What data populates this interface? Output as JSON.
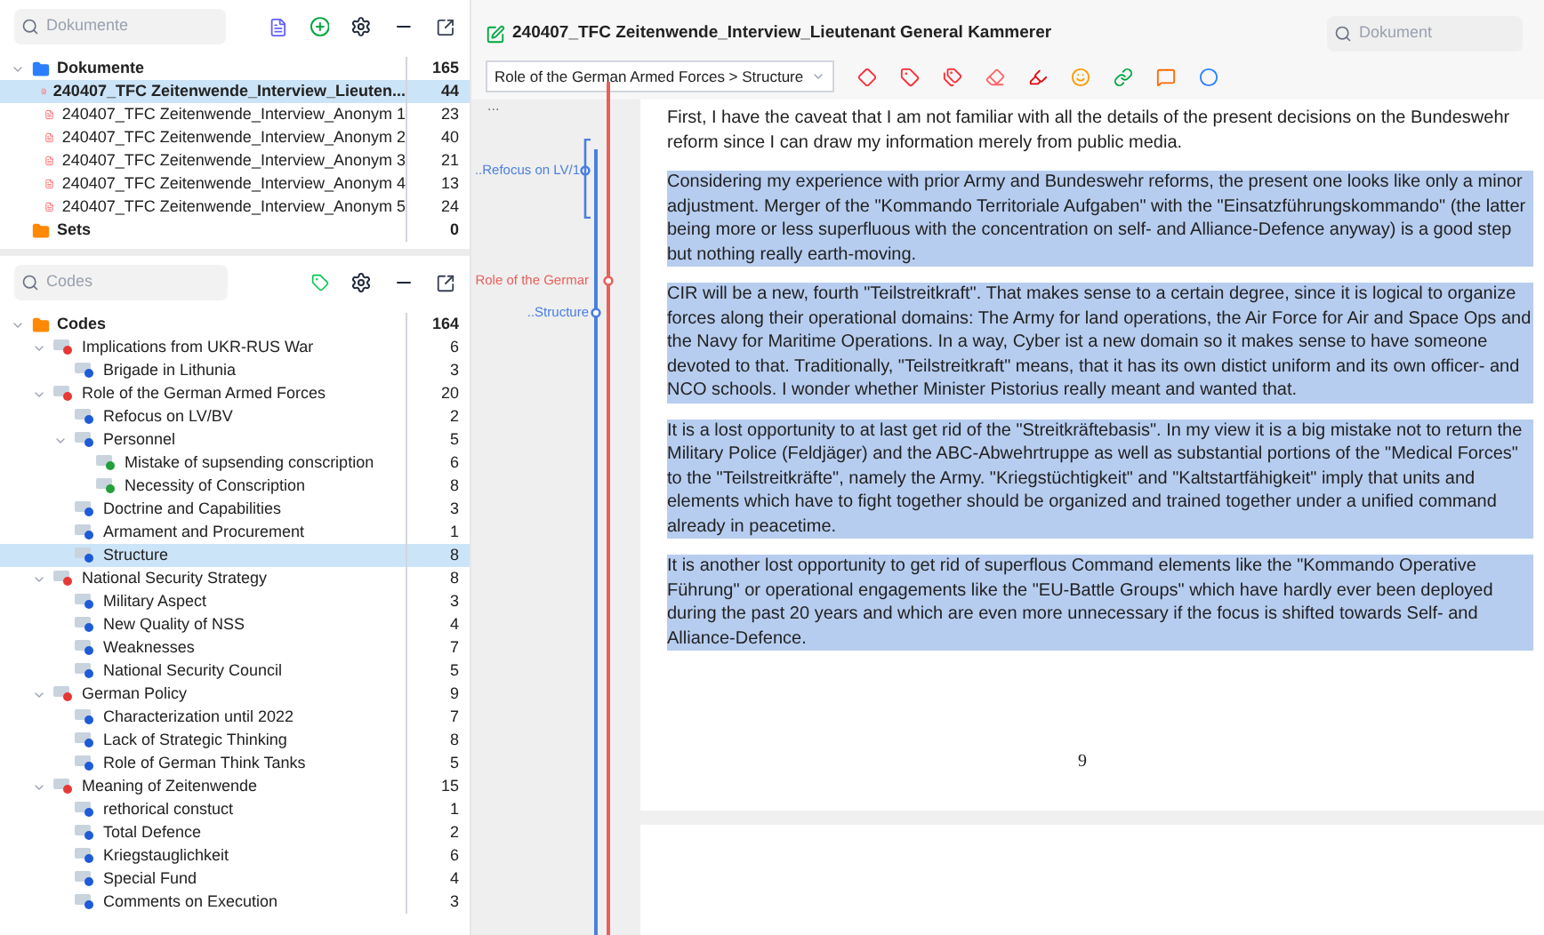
{
  "documents_panel": {
    "search": {
      "placeholder": "Dokumente"
    },
    "root": {
      "label": "Dokumente",
      "count": "165",
      "expanded": true
    },
    "documents": [
      {
        "label": "240407_TFC Zeitenwende_Interview_Lieuten...",
        "count": "44",
        "selected": true
      },
      {
        "label": "240407_TFC Zeitenwende_Interview_Anonym 1",
        "count": "23",
        "selected": false
      },
      {
        "label": "240407_TFC Zeitenwende_Interview_Anonym 2",
        "count": "40",
        "selected": false
      },
      {
        "label": "240407_TFC Zeitenwende_Interview_Anonym 3",
        "count": "21",
        "selected": false
      },
      {
        "label": "240407_TFC Zeitenwende_Interview_Anonym 4",
        "count": "13",
        "selected": false
      },
      {
        "label": "240407_TFC Zeitenwende_Interview_Anonym 5",
        "count": "24",
        "selected": false
      }
    ],
    "sets": {
      "label": "Sets",
      "count": "0"
    }
  },
  "codes_panel": {
    "search": {
      "placeholder": "Codes"
    },
    "root": {
      "label": "Codes",
      "count": "164",
      "expanded": true
    },
    "codes": [
      {
        "label": "Implications from UKR-RUS War",
        "count": "6",
        "color": "#e53935",
        "selected": false,
        "expanded": true,
        "children": [
          {
            "label": "Brigade in Lithunia",
            "count": "3",
            "color": "#1e5bd8",
            "selected": false
          }
        ]
      },
      {
        "label": "Role of the German Armed Forces",
        "count": "20",
        "color": "#e53935",
        "selected": false,
        "expanded": true,
        "children": [
          {
            "label": "Refocus on LV/BV",
            "count": "2",
            "color": "#1e5bd8",
            "selected": false
          },
          {
            "label": "Personnel",
            "count": "5",
            "color": "#1e5bd8",
            "selected": false,
            "expanded": true,
            "children": [
              {
                "label": "Mistake of supsending conscription",
                "count": "6",
                "color": "#22a03a",
                "selected": false
              },
              {
                "label": "Necessity of Conscription",
                "count": "8",
                "color": "#22a03a",
                "selected": false
              }
            ]
          },
          {
            "label": "Doctrine and Capabilities",
            "count": "3",
            "color": "#1e5bd8",
            "selected": false
          },
          {
            "label": "Armament and Procurement",
            "count": "1",
            "color": "#1e5bd8",
            "selected": false
          },
          {
            "label": "Structure",
            "count": "8",
            "color": "#1e5bd8",
            "selected": true
          }
        ]
      },
      {
        "label": "National Security Strategy",
        "count": "8",
        "color": "#e53935",
        "selected": false,
        "expanded": true,
        "children": [
          {
            "label": "Military Aspect",
            "count": "3",
            "color": "#1e5bd8",
            "selected": false
          },
          {
            "label": "New Quality of NSS",
            "count": "4",
            "color": "#1e5bd8",
            "selected": false
          },
          {
            "label": "Weaknesses",
            "count": "7",
            "color": "#1e5bd8",
            "selected": false
          },
          {
            "label": "National Security Council",
            "count": "5",
            "color": "#1e5bd8",
            "selected": false
          }
        ]
      },
      {
        "label": "German Policy",
        "count": "9",
        "color": "#e53935",
        "selected": false,
        "expanded": true,
        "children": [
          {
            "label": "Characterization until 2022",
            "count": "7",
            "color": "#1e5bd8",
            "selected": false
          },
          {
            "label": "Lack of Strategic Thinking",
            "count": "8",
            "color": "#1e5bd8",
            "selected": false
          },
          {
            "label": "Role of German Think Tanks",
            "count": "5",
            "color": "#1e5bd8",
            "selected": false
          }
        ]
      },
      {
        "label": "Meaning of Zeitenwende",
        "count": "15",
        "color": "#e53935",
        "selected": false,
        "expanded": true,
        "children": [
          {
            "label": "rethorical constuct",
            "count": "1",
            "color": "#1e5bd8",
            "selected": false
          },
          {
            "label": "Total Defence",
            "count": "2",
            "color": "#1e5bd8",
            "selected": false
          },
          {
            "label": "Kriegstauglichkeit",
            "count": "6",
            "color": "#1e5bd8",
            "selected": false
          },
          {
            "label": "Special Fund",
            "count": "4",
            "color": "#1e5bd8",
            "selected": false
          },
          {
            "label": "Comments on Execution",
            "count": "3",
            "color": "#1e5bd8",
            "selected": false
          }
        ]
      }
    ]
  },
  "document": {
    "title": "240407_TFC Zeitenwende_Interview_Lieutenant General Kammerer",
    "search": {
      "placeholder": "Dokument"
    },
    "code_selector": "Role of the German Armed Forces > Structure",
    "margin": {
      "more": "...",
      "codings": [
        {
          "label": "..Refocus on LV/1",
          "color": "#4a7fe0"
        },
        {
          "label": "Role of the Germar",
          "color": "#e8605a"
        },
        {
          "label": "..Structure",
          "color": "#4a7fe0"
        }
      ]
    },
    "paragraphs": [
      {
        "text": "First, I have the caveat that I am not familiar with all the details of the present decisions on the Bundeswehr reform since I can draw my information merely from public media.",
        "selected": false
      },
      {
        "text": "Considering my experience with prior Army and Bundeswehr reforms, the present one looks like only a minor adjustment.  Merger of the \"Kommando Territoriale Aufgaben\" with the \"Einsatzführungskommando\" (the latter being more or less superfluous with the concentration on self- and Alliance-Defence anyway) is a good step but nothing really earth-moving.",
        "selected": true
      },
      {
        "text": "CIR will be a new, fourth \"Teilstreitkraft\".  That makes sense to a certain degree, since it is logical to organize forces along their operational domains:  The Army for land operations, the Air Force for Air and Space Ops and the Navy for Maritime Operations.  In a way, Cyber ist a new domain so it makes sense to have someone devoted to that.  Traditionally, \"Teilstreitkraft\" means, that it has its own distict uniform and its own officer- and NCO schools.  I wonder whether Minister Pistorius really meant and wanted that.",
        "selected": true
      },
      {
        "text": "It is a lost opportunity to at last get rid of the \"Streitkräftebasis\".  In my view it is a big mistake not to return the Military Police (Feldjäger) and the ABC-Abwehrtruppe as well as substantial portions of the \"Medical Forces\" to the \"Teilstreitkräfte\", namely the Army.  \"Kriegstüchtigkeit\" and \"Kaltstartfähigkeit\" imply  that units and elements which have to fight together should be organized and trained together under a unified command already in peacetime.",
        "selected": true
      },
      {
        "text": "It is another lost opportunity to get rid of superflous Command elements like the \"Kommando Operative Führung\" or operational engagements like the \"EU-Battle Groups\" which have hardly ever been deployed during the past 20 years and which are even more unnecessary if the focus is shifted towards Self- and Alliance-Defence.",
        "selected": true
      }
    ],
    "page_number": "9"
  }
}
